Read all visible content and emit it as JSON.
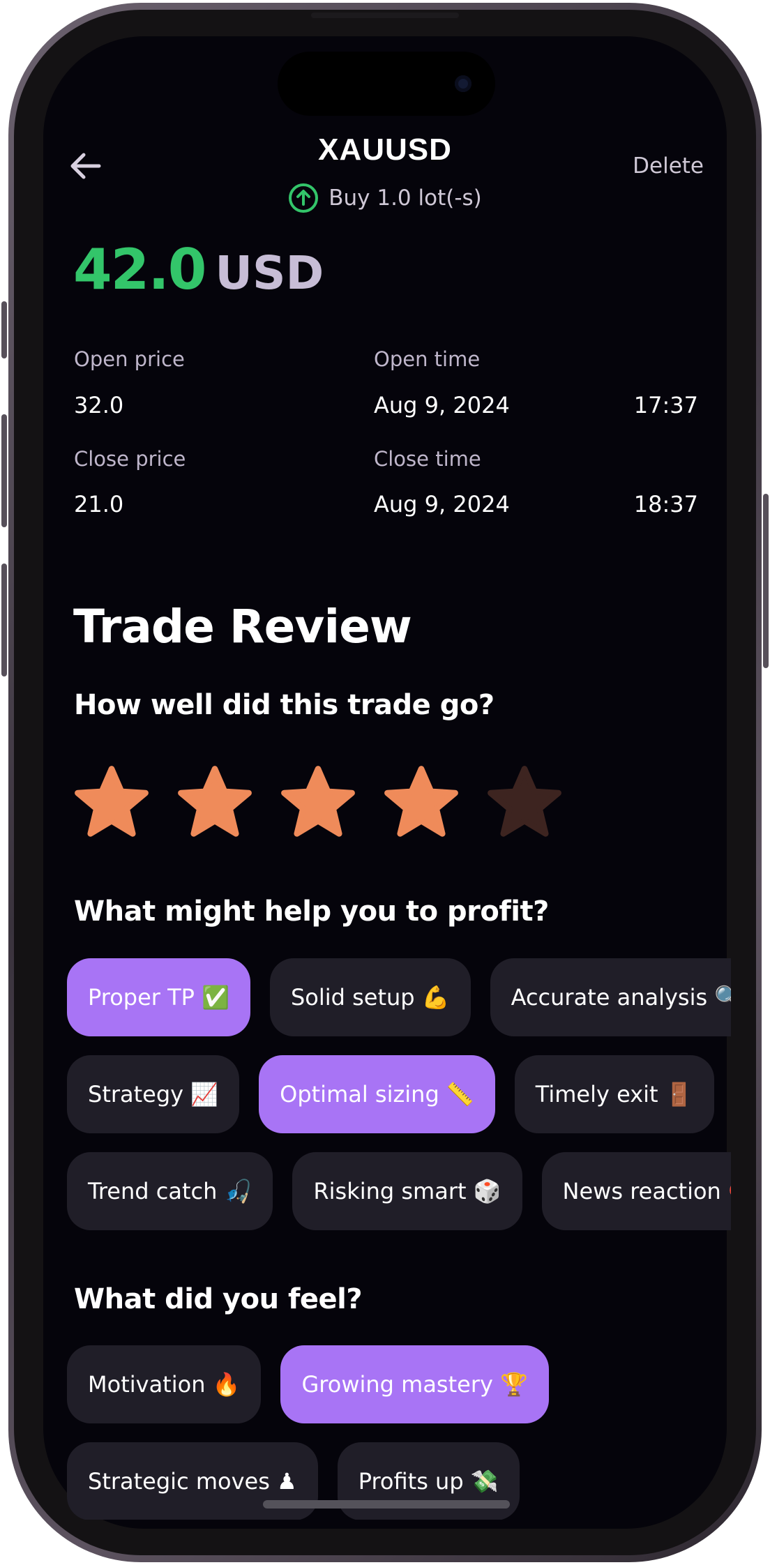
{
  "header": {
    "title": "XAUUSD",
    "delete_label": "Delete",
    "trade_summary": "Buy 1.0 lot(-s)",
    "direction_color": "#33c56a"
  },
  "pnl": {
    "value": "42.0",
    "currency": "USD",
    "color": "#33c56a"
  },
  "details": {
    "open_price_label": "Open price",
    "open_price": "32.0",
    "open_time_label": "Open time",
    "open_date": "Aug 9, 2024",
    "open_clock": "17:37",
    "close_price_label": "Close price",
    "close_price": "21.0",
    "close_time_label": "Close time",
    "close_date": "Aug 9, 2024",
    "close_clock": "18:37"
  },
  "review": {
    "title": "Trade Review",
    "rating_question": "How well did this trade go?",
    "rating": 4,
    "rating_max": 5,
    "profit_question": "What might help you to profit?",
    "profit_rows": [
      [
        {
          "label": "Proper TP ✅",
          "selected": true
        },
        {
          "label": "Solid setup 💪",
          "selected": false
        },
        {
          "label": "Accurate analysis 🔍",
          "selected": false
        }
      ],
      [
        {
          "label": "Strategy 📈",
          "selected": false
        },
        {
          "label": "Optimal sizing 📏",
          "selected": true
        },
        {
          "label": "Timely exit 🚪",
          "selected": false
        },
        {
          "label": "",
          "selected": false
        }
      ],
      [
        {
          "label": "Trend catch 🎣",
          "selected": false
        },
        {
          "label": "Risking smart 🎲",
          "selected": false
        },
        {
          "label": "News reaction 📢",
          "selected": false
        }
      ]
    ],
    "feel_question": "What did you feel?",
    "feel_rows": [
      [
        {
          "label": "Motivation 🔥",
          "selected": false
        },
        {
          "label": "Growing mastery 🏆",
          "selected": true
        }
      ],
      [
        {
          "label": "Strategic moves ♟",
          "selected": false
        },
        {
          "label": "Profits up 💸",
          "selected": false
        }
      ]
    ]
  },
  "colors": {
    "background": "#05040b",
    "chip": "#201e28",
    "chip_selected": "#a874f5",
    "star_on": "#ef8b5a",
    "star_off": "#3d2420"
  }
}
